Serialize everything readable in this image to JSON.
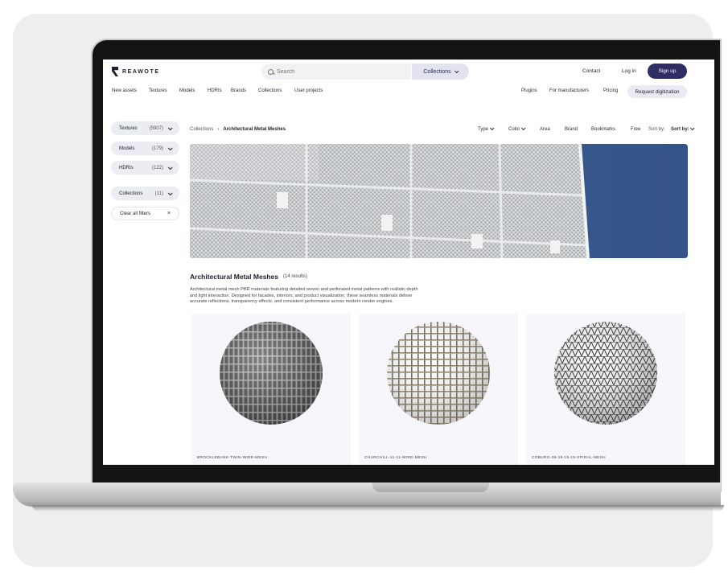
{
  "brand": {
    "name": "REAWOTE"
  },
  "search": {
    "placeholder": "Search"
  },
  "header": {
    "collections_label": "Collections",
    "contact": "Contact",
    "login": "Log in",
    "signup": "Sign up"
  },
  "nav": {
    "left": [
      "New assets",
      "Textures",
      "Models",
      "HDRIs",
      "Brands",
      "Collections",
      "User projects"
    ],
    "plugins": "Plugins",
    "manufacturers": "For manufacturers",
    "pricing": "Pricing",
    "request": "Request digitization"
  },
  "filters": [
    {
      "label": "Textures",
      "count": "(5907)"
    },
    {
      "label": "Models",
      "count": "(179)"
    },
    {
      "label": "HDRIs",
      "count": "(122)"
    },
    {
      "label": "Collections",
      "count": "(11)"
    }
  ],
  "clear_filters": "Clear all filters",
  "breadcrumb": {
    "root": "Collections",
    "separator": "›",
    "current": "Architectural Metal Meshes"
  },
  "toolbar": {
    "type": "Type",
    "color": "Color",
    "area": "Area",
    "brand": "Brand",
    "bookmarks": "Bookmarks",
    "free": "Free",
    "sortby_label": "Sort by:",
    "sortby_value": "Sort by:"
  },
  "collection": {
    "title": "Architectural Metal Meshes",
    "results": "(14 results)",
    "description": "Architectural metal mesh PBR materials featuring detailed woven and perforated metal patterns with realistic depth and light interaction. Designed for facades, interiors, and product visualization, these seamless materials deliver accurate reflections, transparency effects, and consistent performance across modern render engines."
  },
  "products": [
    {
      "name": "BROCKLEBANK-TWIN-WIRE-MESH"
    },
    {
      "name": "CHURCHILL-11-11-WIRE-MESH"
    },
    {
      "name": "COBURG-36-18-15-15-SPIRAL-MESH"
    }
  ],
  "colors": {
    "accent": "#2e2e64",
    "sky": "#3a5a8f"
  }
}
